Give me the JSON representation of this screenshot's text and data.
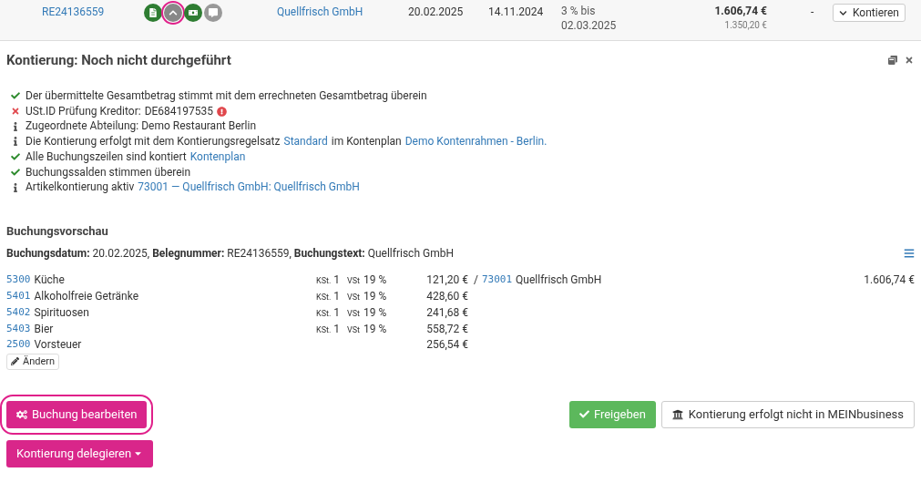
{
  "invoice_row": {
    "number": "RE24136559",
    "icons": [
      {
        "kind": "document",
        "highlighted": false
      },
      {
        "kind": "collapse",
        "highlighted": true
      },
      {
        "kind": "money",
        "highlighted": false
      },
      {
        "kind": "comment",
        "highlighted": false
      }
    ],
    "supplier": "Quellfrisch GmbH",
    "date": "20.02.2025",
    "due": "14.11.2024",
    "discount": [
      "3 % bis",
      "02.03.2025"
    ],
    "amount": "1.606,74 €",
    "net": "1.350,20 €",
    "dash": "-",
    "action": "Kontieren"
  },
  "panel": {
    "title": "Kontierung: Noch nicht durchgeführt",
    "checks": [
      {
        "kind": "ok",
        "parts": [
          {
            "text": "Der übermittelte Gesamtbetrag stimmt mit dem errechneten Gesamtbetrag überein",
            "link": false
          }
        ]
      },
      {
        "kind": "error",
        "parts": [
          {
            "text": "USt.ID Prüfung Kreditor:",
            "link": false
          },
          {
            "text": "DE684197535",
            "link": false
          }
        ],
        "warning": true
      },
      {
        "kind": "info",
        "parts": [
          {
            "text": "Zugeordnete Abteilung: Demo Restaurant Berlin",
            "link": false
          }
        ]
      },
      {
        "kind": "info",
        "parts": [
          {
            "text": "Die Kontierung erfolgt mit dem Kontierungsregelsatz",
            "link": false
          },
          {
            "text": "Standard",
            "link": true
          },
          {
            "text": "im Kontenplan",
            "link": false
          },
          {
            "text": "Demo Kontenrahmen - Berlin.",
            "link": true
          }
        ]
      },
      {
        "kind": "ok",
        "parts": [
          {
            "text": "Alle Buchungszeilen sind kontiert",
            "link": false
          },
          {
            "text": "Kontenplan",
            "link": true
          }
        ]
      },
      {
        "kind": "ok",
        "parts": [
          {
            "text": "Buchungssalden stimmen überein",
            "link": false
          }
        ]
      },
      {
        "kind": "info",
        "parts": [
          {
            "text": "Artikelkontierung aktiv",
            "link": false
          },
          {
            "text": "73001 — Quellfrisch GmbH: Quellfrisch GmbH",
            "link": true
          }
        ]
      }
    ],
    "preview": {
      "title": "Buchungsvorschau",
      "meta": "**Buchungsdatum:** 20.02.2025, **Belegnummer:** RE24136559, **Buchungstext:** Quellfrisch GmbH",
      "lines": [
        {
          "account": "5300",
          "name": "Küche",
          "kst_label": "KSt.",
          "kst": "1",
          "vst_label": "VSt",
          "vst": "19 %",
          "amount": "121,20 €",
          "sep": "/",
          "credit_account": "73001",
          "credit_name": "Quellfrisch GmbH",
          "total": "1.606,74 €"
        },
        {
          "account": "5401",
          "name": "Alkoholfreie Getränke",
          "kst_label": "KSt.",
          "kst": "1",
          "vst_label": "VSt",
          "vst": "19 %",
          "amount": "428,60 €"
        },
        {
          "account": "5402",
          "name": "Spirituosen",
          "kst_label": "KSt.",
          "kst": "1",
          "vst_label": "VSt",
          "vst": "19 %",
          "amount": "241,68 €"
        },
        {
          "account": "5403",
          "name": "Bier",
          "kst_label": "KSt.",
          "kst": "1",
          "vst_label": "VSt",
          "vst": "19 %",
          "amount": "558,72 €"
        },
        {
          "account": "2500",
          "name": "Vorsteuer",
          "amount": "256,54 €"
        }
      ],
      "edit": "Ändern"
    },
    "edit_booking": {
      "label": "Buchung bearbeiten",
      "highlighted": true
    },
    "release": "Freigeben",
    "external": "Kontierung erfolgt nicht in MEINbusiness",
    "delegate": "Kontierung delegieren"
  }
}
